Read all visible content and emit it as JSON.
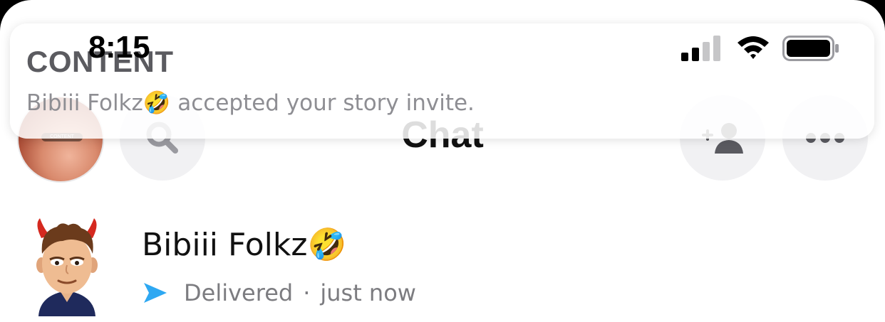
{
  "status_bar": {
    "time": "8:15"
  },
  "notification": {
    "title": "CONTENT",
    "message": "Bibiii Folkz🤣 accepted your story invite."
  },
  "header": {
    "title": "Chat",
    "avatar_tag": "CONTENT"
  },
  "chat_list": [
    {
      "name": "Bibiii Folkz🤣",
      "status": "Delivered",
      "separator": "·",
      "time": "just now",
      "status_color": "#2ea8f2"
    }
  ]
}
